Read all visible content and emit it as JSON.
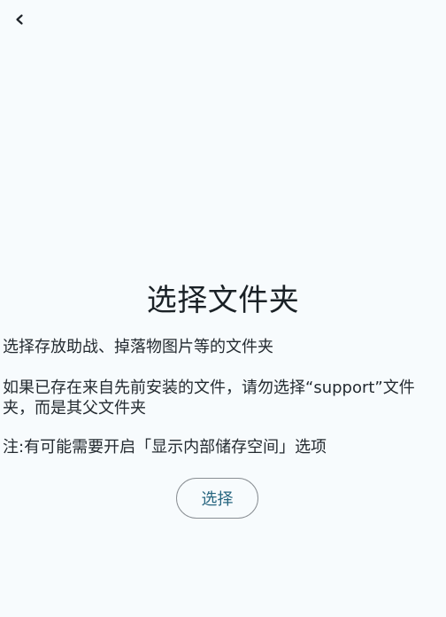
{
  "nav": {
    "back_icon": "chevron-left-icon"
  },
  "main": {
    "title": "选择文件夹",
    "paragraph1": "选择存放助战、掉落物图片等的文件夹",
    "paragraph2": "如果已存在来自先前安装的文件，请勿选择“support”文件夹，而是其父文件夹",
    "paragraph3": "注:有可能需要开启「显示内部储存空间」选项",
    "choose_label": "选择"
  },
  "colors": {
    "background": "#f7fbfd",
    "accent": "#26657f",
    "text": "#1d2228",
    "button_border": "#8a8f94"
  }
}
